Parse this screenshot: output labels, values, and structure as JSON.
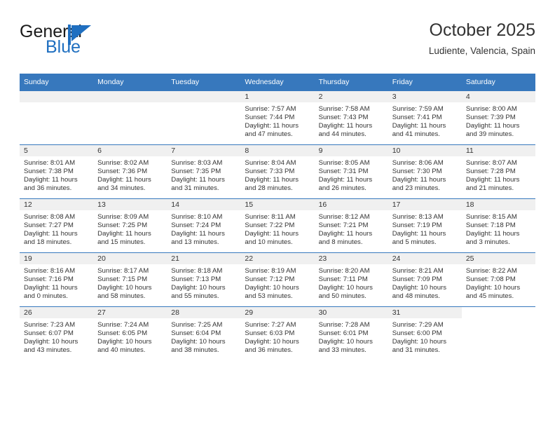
{
  "brand": {
    "name_part1": "General",
    "name_part2": "Blue",
    "accent_color": "#1f6fc0"
  },
  "header": {
    "title": "October 2025",
    "subtitle": "Ludiente, Valencia, Spain"
  },
  "theme": {
    "header_row_bg": "#3778bd",
    "daynum_bg": "#f0f0f0",
    "grid_line": "#3778bd",
    "text": "#333333"
  },
  "weekday_headers": [
    "Sunday",
    "Monday",
    "Tuesday",
    "Wednesday",
    "Thursday",
    "Friday",
    "Saturday"
  ],
  "labels": {
    "sunrise_prefix": "Sunrise:",
    "sunset_prefix": "Sunset:",
    "daylight_prefix": "Daylight:"
  },
  "weeks": [
    [
      {
        "day": "",
        "l1": "",
        "l2": "",
        "l3": "",
        "l4": ""
      },
      {
        "day": "",
        "l1": "",
        "l2": "",
        "l3": "",
        "l4": ""
      },
      {
        "day": "",
        "l1": "",
        "l2": "",
        "l3": "",
        "l4": ""
      },
      {
        "day": "1",
        "l1": "Sunrise: 7:57 AM",
        "l2": "Sunset: 7:44 PM",
        "l3": "Daylight: 11 hours",
        "l4": "and 47 minutes."
      },
      {
        "day": "2",
        "l1": "Sunrise: 7:58 AM",
        "l2": "Sunset: 7:43 PM",
        "l3": "Daylight: 11 hours",
        "l4": "and 44 minutes."
      },
      {
        "day": "3",
        "l1": "Sunrise: 7:59 AM",
        "l2": "Sunset: 7:41 PM",
        "l3": "Daylight: 11 hours",
        "l4": "and 41 minutes."
      },
      {
        "day": "4",
        "l1": "Sunrise: 8:00 AM",
        "l2": "Sunset: 7:39 PM",
        "l3": "Daylight: 11 hours",
        "l4": "and 39 minutes."
      }
    ],
    [
      {
        "day": "5",
        "l1": "Sunrise: 8:01 AM",
        "l2": "Sunset: 7:38 PM",
        "l3": "Daylight: 11 hours",
        "l4": "and 36 minutes."
      },
      {
        "day": "6",
        "l1": "Sunrise: 8:02 AM",
        "l2": "Sunset: 7:36 PM",
        "l3": "Daylight: 11 hours",
        "l4": "and 34 minutes."
      },
      {
        "day": "7",
        "l1": "Sunrise: 8:03 AM",
        "l2": "Sunset: 7:35 PM",
        "l3": "Daylight: 11 hours",
        "l4": "and 31 minutes."
      },
      {
        "day": "8",
        "l1": "Sunrise: 8:04 AM",
        "l2": "Sunset: 7:33 PM",
        "l3": "Daylight: 11 hours",
        "l4": "and 28 minutes."
      },
      {
        "day": "9",
        "l1": "Sunrise: 8:05 AM",
        "l2": "Sunset: 7:31 PM",
        "l3": "Daylight: 11 hours",
        "l4": "and 26 minutes."
      },
      {
        "day": "10",
        "l1": "Sunrise: 8:06 AM",
        "l2": "Sunset: 7:30 PM",
        "l3": "Daylight: 11 hours",
        "l4": "and 23 minutes."
      },
      {
        "day": "11",
        "l1": "Sunrise: 8:07 AM",
        "l2": "Sunset: 7:28 PM",
        "l3": "Daylight: 11 hours",
        "l4": "and 21 minutes."
      }
    ],
    [
      {
        "day": "12",
        "l1": "Sunrise: 8:08 AM",
        "l2": "Sunset: 7:27 PM",
        "l3": "Daylight: 11 hours",
        "l4": "and 18 minutes."
      },
      {
        "day": "13",
        "l1": "Sunrise: 8:09 AM",
        "l2": "Sunset: 7:25 PM",
        "l3": "Daylight: 11 hours",
        "l4": "and 15 minutes."
      },
      {
        "day": "14",
        "l1": "Sunrise: 8:10 AM",
        "l2": "Sunset: 7:24 PM",
        "l3": "Daylight: 11 hours",
        "l4": "and 13 minutes."
      },
      {
        "day": "15",
        "l1": "Sunrise: 8:11 AM",
        "l2": "Sunset: 7:22 PM",
        "l3": "Daylight: 11 hours",
        "l4": "and 10 minutes."
      },
      {
        "day": "16",
        "l1": "Sunrise: 8:12 AM",
        "l2": "Sunset: 7:21 PM",
        "l3": "Daylight: 11 hours",
        "l4": "and 8 minutes."
      },
      {
        "day": "17",
        "l1": "Sunrise: 8:13 AM",
        "l2": "Sunset: 7:19 PM",
        "l3": "Daylight: 11 hours",
        "l4": "and 5 minutes."
      },
      {
        "day": "18",
        "l1": "Sunrise: 8:15 AM",
        "l2": "Sunset: 7:18 PM",
        "l3": "Daylight: 11 hours",
        "l4": "and 3 minutes."
      }
    ],
    [
      {
        "day": "19",
        "l1": "Sunrise: 8:16 AM",
        "l2": "Sunset: 7:16 PM",
        "l3": "Daylight: 11 hours",
        "l4": "and 0 minutes."
      },
      {
        "day": "20",
        "l1": "Sunrise: 8:17 AM",
        "l2": "Sunset: 7:15 PM",
        "l3": "Daylight: 10 hours",
        "l4": "and 58 minutes."
      },
      {
        "day": "21",
        "l1": "Sunrise: 8:18 AM",
        "l2": "Sunset: 7:13 PM",
        "l3": "Daylight: 10 hours",
        "l4": "and 55 minutes."
      },
      {
        "day": "22",
        "l1": "Sunrise: 8:19 AM",
        "l2": "Sunset: 7:12 PM",
        "l3": "Daylight: 10 hours",
        "l4": "and 53 minutes."
      },
      {
        "day": "23",
        "l1": "Sunrise: 8:20 AM",
        "l2": "Sunset: 7:11 PM",
        "l3": "Daylight: 10 hours",
        "l4": "and 50 minutes."
      },
      {
        "day": "24",
        "l1": "Sunrise: 8:21 AM",
        "l2": "Sunset: 7:09 PM",
        "l3": "Daylight: 10 hours",
        "l4": "and 48 minutes."
      },
      {
        "day": "25",
        "l1": "Sunrise: 8:22 AM",
        "l2": "Sunset: 7:08 PM",
        "l3": "Daylight: 10 hours",
        "l4": "and 45 minutes."
      }
    ],
    [
      {
        "day": "26",
        "l1": "Sunrise: 7:23 AM",
        "l2": "Sunset: 6:07 PM",
        "l3": "Daylight: 10 hours",
        "l4": "and 43 minutes."
      },
      {
        "day": "27",
        "l1": "Sunrise: 7:24 AM",
        "l2": "Sunset: 6:05 PM",
        "l3": "Daylight: 10 hours",
        "l4": "and 40 minutes."
      },
      {
        "day": "28",
        "l1": "Sunrise: 7:25 AM",
        "l2": "Sunset: 6:04 PM",
        "l3": "Daylight: 10 hours",
        "l4": "and 38 minutes."
      },
      {
        "day": "29",
        "l1": "Sunrise: 7:27 AM",
        "l2": "Sunset: 6:03 PM",
        "l3": "Daylight: 10 hours",
        "l4": "and 36 minutes."
      },
      {
        "day": "30",
        "l1": "Sunrise: 7:28 AM",
        "l2": "Sunset: 6:01 PM",
        "l3": "Daylight: 10 hours",
        "l4": "and 33 minutes."
      },
      {
        "day": "31",
        "l1": "Sunrise: 7:29 AM",
        "l2": "Sunset: 6:00 PM",
        "l3": "Daylight: 10 hours",
        "l4": "and 31 minutes."
      },
      {
        "day": "",
        "l1": "",
        "l2": "",
        "l3": "",
        "l4": "",
        "blank": true
      }
    ]
  ]
}
